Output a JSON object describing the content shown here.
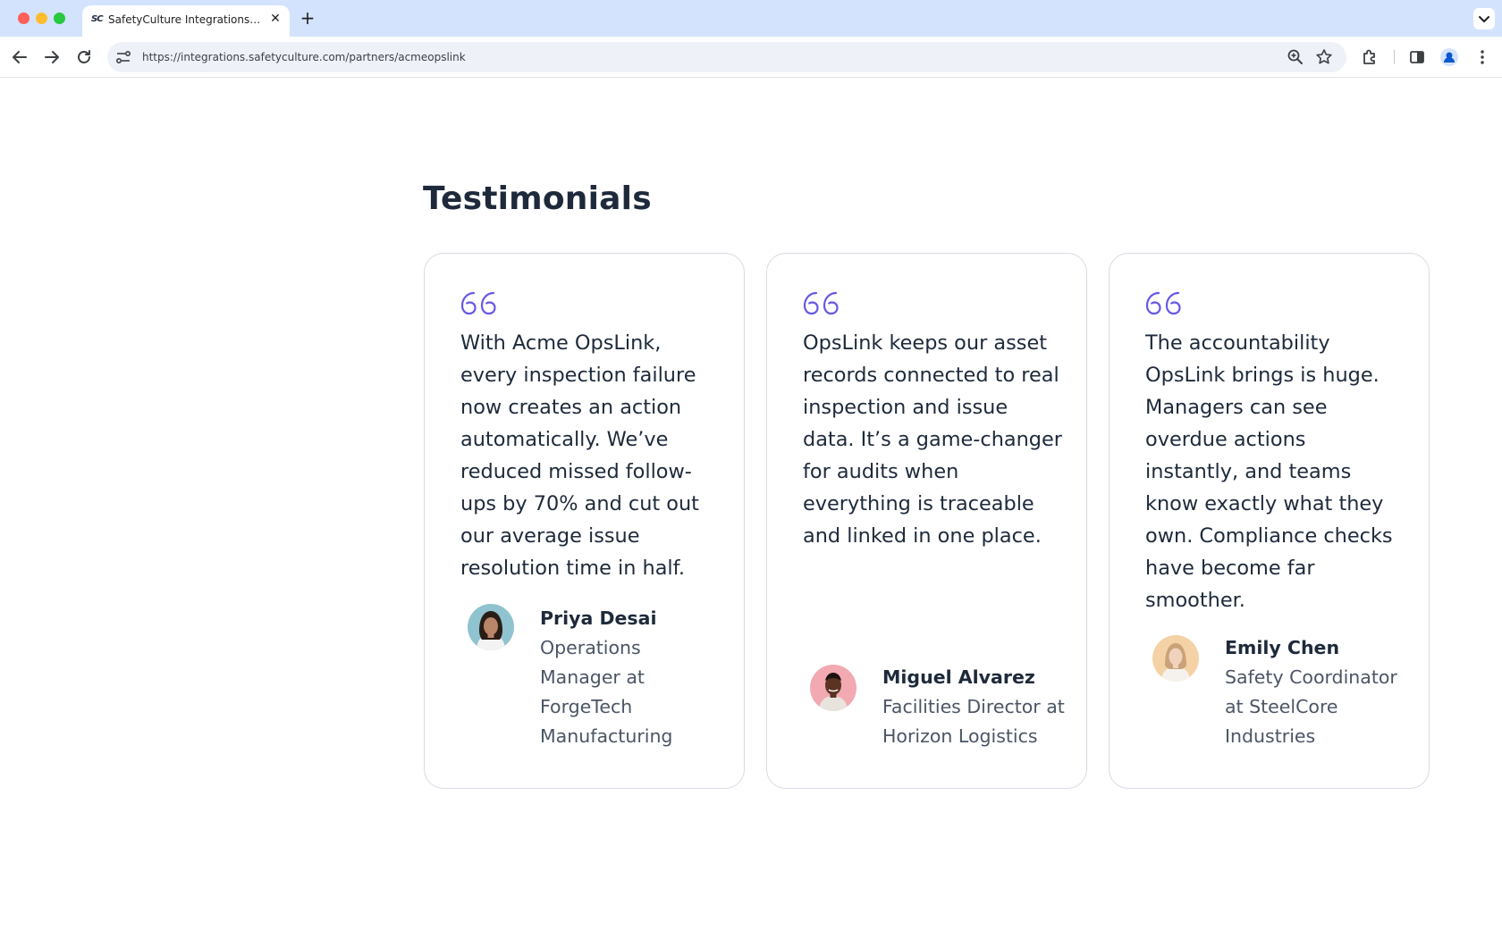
{
  "browser": {
    "tab_title": "SafetyCulture Integrations Marketplace",
    "tab_favicon": "SC",
    "tab_close": "✕",
    "new_tab": "+",
    "url": "https://integrations.safetyculture.com/partners/acmeopslink"
  },
  "page": {
    "heading": "Testimonials",
    "accent_color": "#6559e6"
  },
  "testimonials": [
    {
      "quote": "With Acme OpsLink, every inspection failure now creates an action automatically. We’ve reduced missed follow-ups by 70% and cut out our average issue resolution time in half.",
      "name": "Priya Desai",
      "role": "Operations Manager at ForgeTech Manufacturing"
    },
    {
      "quote": "OpsLink keeps our asset records connected to real inspection and issue data. It’s a game-changer for audits when everything is traceable and linked in one place.",
      "name": "Miguel Alvarez",
      "role": "Facilities Director at Horizon Logistics"
    },
    {
      "quote": "The accountability OpsLink brings is huge. Managers can see overdue actions instantly, and teams know exactly what they own. Compliance checks have become far smoother.",
      "name": "Emily Chen",
      "role": "Safety Coordinator at SteelCore Industries"
    }
  ]
}
